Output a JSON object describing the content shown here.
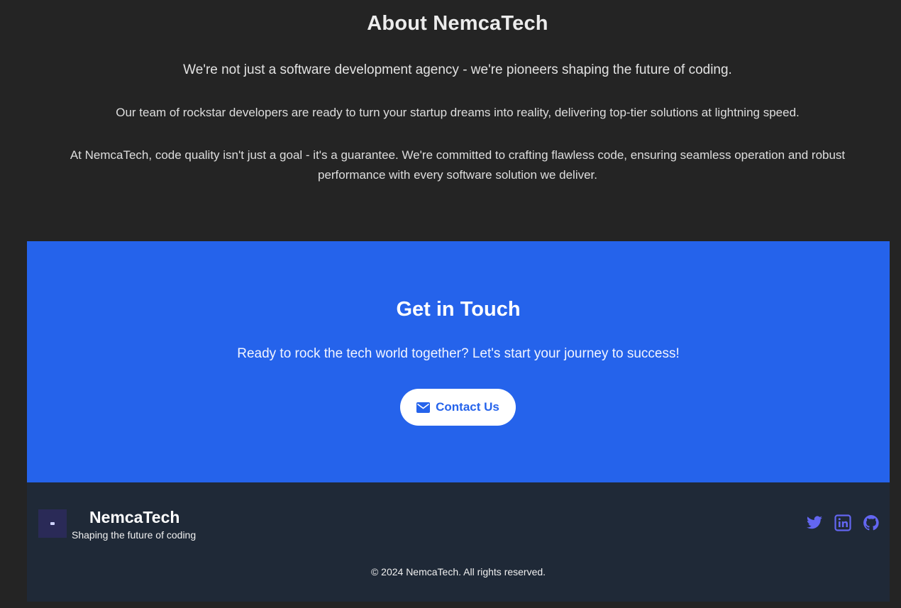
{
  "about": {
    "title": "About NemcaTech",
    "lead": "We're not just a software development agency - we're pioneers shaping the future of coding.",
    "paragraph_2": "Our team of rockstar developers are ready to turn your startup dreams into reality, delivering top-tier solutions at lightning speed.",
    "paragraph_3": "At NemcaTech, code quality isn't just a goal - it's a guarantee. We're committed to crafting flawless code, ensuring seamless operation and robust performance with every software solution we deliver."
  },
  "cta": {
    "title": "Get in Touch",
    "text": "Ready to rock the tech world together? Let's start your journey to success!",
    "button_label": "Contact Us",
    "button_icon": "envelope-icon",
    "background_color": "#2563eb"
  },
  "footer": {
    "brand_name": "NemcaTech",
    "tagline": "Shaping the future of coding",
    "copyright": "© 2024 NemcaTech. All rights reserved.",
    "social_icons": [
      "twitter-icon",
      "linkedin-icon",
      "github-icon"
    ],
    "social_color": "#6366f1",
    "background_color": "#1f2937"
  }
}
